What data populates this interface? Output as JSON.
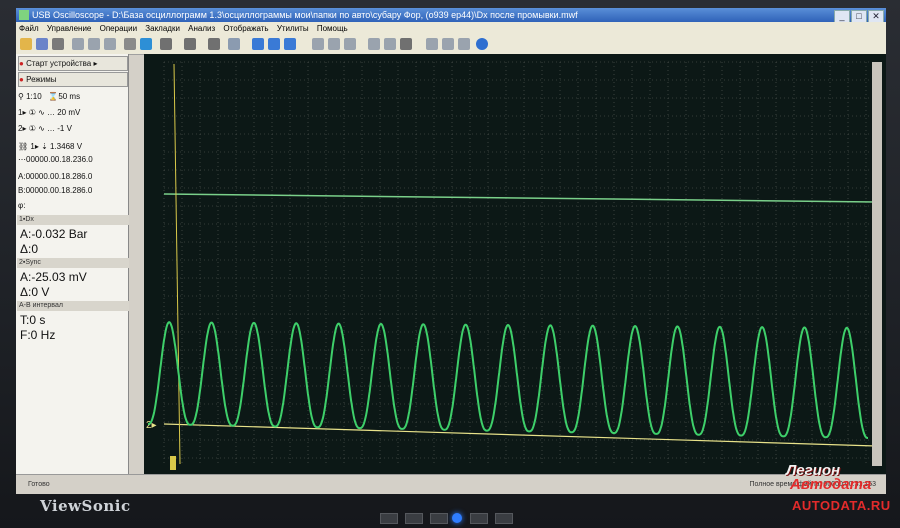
{
  "window": {
    "title": "USB Oscilloscope - D:\\База осциллограмм 1.3\\осциллограммы мои\\папки по авто\\субару Фор, (о939 ер44)\\Dx после промывки.mwf",
    "controls": [
      "_",
      "□",
      "✕"
    ]
  },
  "menu": [
    "Файл",
    "Управление",
    "Операции",
    "Закладки",
    "Анализ",
    "Отображать",
    "Утилиты",
    "Помощь"
  ],
  "panel": {
    "start_button": "Старт устройства",
    "modes_button": "Режимы",
    "timebase": {
      "scale": "1:10",
      "time_div": "50 ms"
    },
    "ch1": {
      "label": "1",
      "value": "20 mV"
    },
    "ch2": {
      "label": "2",
      "value": "-1 V"
    },
    "trigger": {
      "value": "1.3468 V",
      "time": "00000.00.18.236.0"
    },
    "marker_a": {
      "label": "A:",
      "value": "00000.00.18.286.0"
    },
    "marker_b": {
      "label": "B:",
      "value": "00000.00.18.286.0"
    },
    "phi": {
      "label": "φ:"
    },
    "section_dx": "1▪Dx",
    "dx_a": "A:-0.032 Bar",
    "dx_delta": "Δ:0",
    "section_sync": "2▪Sync",
    "sync_a": "A:-25.03 mV",
    "sync_delta": "Δ:0 V",
    "section_ab": "A-B интервал",
    "ab_t": "T:0 s",
    "ab_f": "F:0 Hz"
  },
  "scope": {
    "channel2_marker": "2▸",
    "grid_color": "#5a5f5a",
    "trace_color": "#3ecf6a",
    "level_line_color": "#7ad08a",
    "baseline_color": "#e8e28a",
    "cursor_color": "#d8c84a",
    "cycles_visible": 17
  },
  "status": {
    "left": "Готово",
    "right": "Полное время файла: 00000:00:31:153"
  },
  "monitor": {
    "brand": "ViewSonic"
  },
  "watermark": {
    "line1": "Легион",
    "line2": "Автодата",
    "line3": "AUTODATA.RU"
  }
}
